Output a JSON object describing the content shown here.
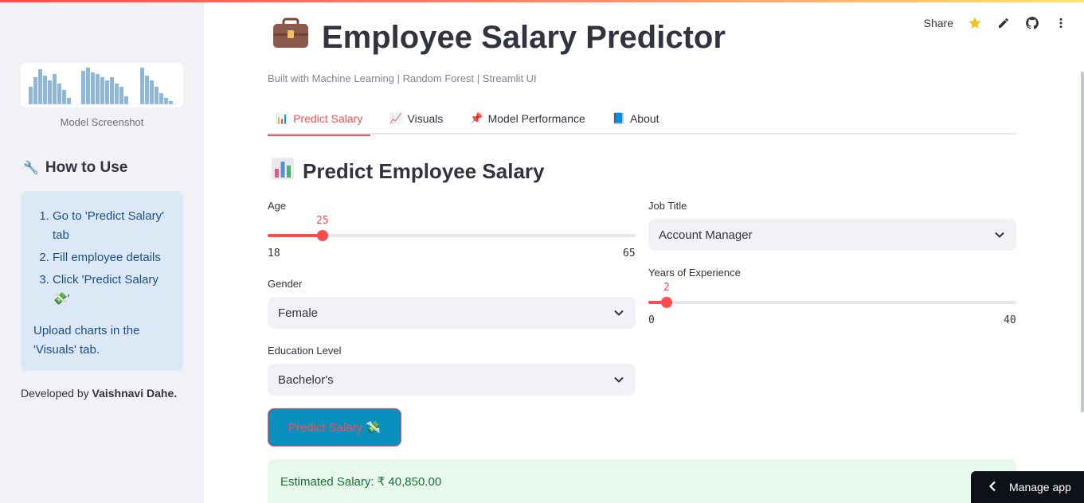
{
  "app": {
    "title": "Employee Salary Predictor",
    "subtitle": "Built with Machine Learning | Random Forest | Streamlit UI",
    "accent_color": "#ff4b4b"
  },
  "toolbar": {
    "share_label": "Share",
    "icons": [
      "star-icon",
      "edit-icon",
      "github-icon",
      "more-icon"
    ]
  },
  "sidebar": {
    "image_caption": "Model Screenshot",
    "howto_title": "How to Use",
    "steps": [
      "Go to 'Predict Salary' tab",
      "Fill employee details",
      "Click 'Predict Salary 💸'"
    ],
    "note": "Upload charts in the 'Visuals' tab.",
    "dev_prefix": "Developed by ",
    "dev_name": "Vaishnavi Dahe."
  },
  "tabs": [
    {
      "icon": "📊",
      "label": "Predict Salary",
      "active": true
    },
    {
      "icon": "📈",
      "label": "Visuals",
      "active": false
    },
    {
      "icon": "📌",
      "label": "Model Performance",
      "active": false
    },
    {
      "icon": "📘",
      "label": "About",
      "active": false
    }
  ],
  "form": {
    "section_title": "Predict Employee Salary",
    "age": {
      "label": "Age",
      "value": "25",
      "min": "18",
      "max": "65",
      "fraction": 0.149
    },
    "gender": {
      "label": "Gender",
      "value": "Female"
    },
    "education": {
      "label": "Education Level",
      "value": "Bachelor's"
    },
    "job_title": {
      "label": "Job Title",
      "value": "Account Manager"
    },
    "experience": {
      "label": "Years of Experience",
      "value": "2",
      "min": "0",
      "max": "40",
      "fraction": 0.05
    },
    "predict_button": "Predict Salary 💸"
  },
  "result": {
    "text": "Estimated Salary: ₹ 40,850.00"
  },
  "manage_app": "Manage app"
}
